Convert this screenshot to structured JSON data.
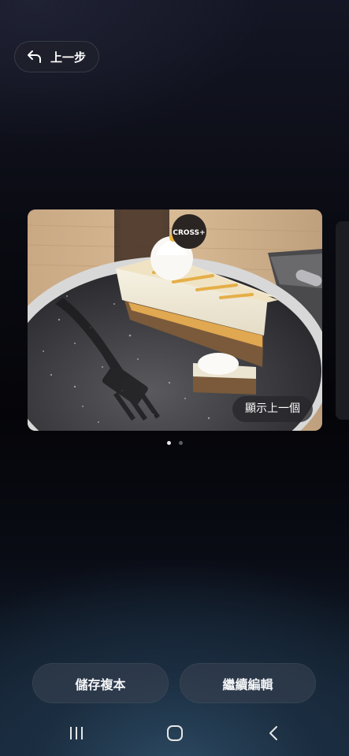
{
  "header": {
    "back_label": "上一步",
    "back_icon": "undo-arrow-icon"
  },
  "photo": {
    "description_icon": "cake-photo",
    "overlay_button_label": "顯示上一個",
    "logo_text": "CROSS+"
  },
  "pager": {
    "count": 2,
    "active_index": 0
  },
  "actions": {
    "save_copy_label": "儲存複本",
    "continue_edit_label": "繼續編輯"
  },
  "navbar": {
    "recent_icon": "recent-apps-icon",
    "home_icon": "home-icon",
    "back_icon": "back-chevron-icon"
  },
  "colors": {
    "accent_dot": "#e8e8ea",
    "button_bg": "#3a4452"
  }
}
